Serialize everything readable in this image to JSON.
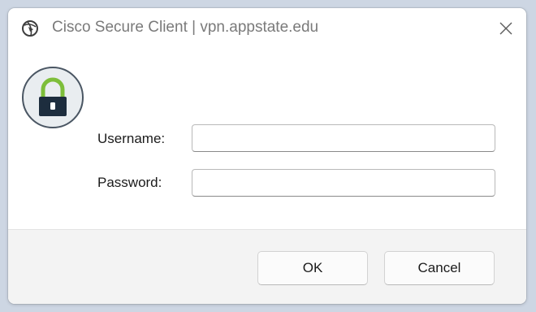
{
  "window": {
    "title": "Cisco Secure Client | vpn.appstate.edu",
    "icon": "cisco-globe-icon",
    "close_icon": "close-icon"
  },
  "form": {
    "username_label": "Username:",
    "username_value": "",
    "password_label": "Password:",
    "password_value": ""
  },
  "buttons": {
    "ok_label": "OK",
    "cancel_label": "Cancel"
  },
  "colors": {
    "lock_shackle": "#7dbe3a",
    "lock_body": "#1d2d3e",
    "badge_border": "#4a5663",
    "backdrop": "#cdd6e3"
  }
}
